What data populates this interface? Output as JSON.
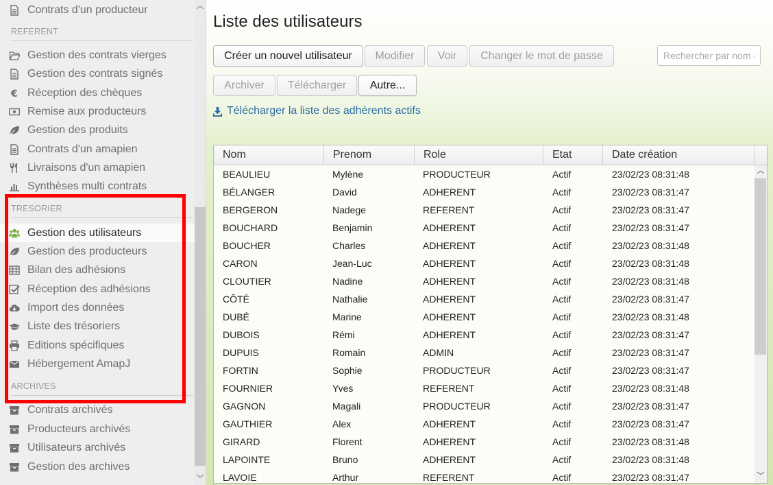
{
  "sidebar": {
    "items_top": [
      {
        "label": "Contrats d'un producteur",
        "icon": "file-icon"
      }
    ],
    "section_referent": "REFERENT",
    "items_referent": [
      {
        "label": "Gestion des contrats vierges",
        "icon": "folder-open-icon"
      },
      {
        "label": "Gestion des contrats signés",
        "icon": "file-icon"
      },
      {
        "label": "Réception des chèques",
        "icon": "euro-icon"
      },
      {
        "label": "Remise aux producteurs",
        "icon": "money-icon"
      },
      {
        "label": "Gestion des produits",
        "icon": "leaf-icon"
      },
      {
        "label": "Contrats d'un amapien",
        "icon": "file-icon"
      },
      {
        "label": "Livraisons d'un amapien",
        "icon": "cutlery-icon"
      },
      {
        "label": "Synthèses multi contrats",
        "icon": "bar-chart-icon"
      }
    ],
    "section_tresorier": "TRESORIER",
    "items_tresorier": [
      {
        "label": "Gestion des utilisateurs",
        "icon": "users-icon",
        "active": true
      },
      {
        "label": "Gestion des producteurs",
        "icon": "leaf-icon"
      },
      {
        "label": "Bilan des adhésions",
        "icon": "table-icon"
      },
      {
        "label": "Réception des adhésions",
        "icon": "check-square-icon"
      },
      {
        "label": "Import des données",
        "icon": "cloud-download-icon"
      },
      {
        "label": "Liste des trésoriers",
        "icon": "graduation-cap-icon"
      },
      {
        "label": "Editions spécifiques",
        "icon": "print-icon"
      },
      {
        "label": "Hébergement AmapJ",
        "icon": "envelope-icon"
      }
    ],
    "section_archives": "ARCHIVES",
    "items_archives": [
      {
        "label": "Contrats archivés",
        "icon": "archive-icon"
      },
      {
        "label": "Producteurs archivés",
        "icon": "archive-icon"
      },
      {
        "label": "Utilisateurs archivés",
        "icon": "archive-icon"
      },
      {
        "label": "Gestion des archives",
        "icon": "archive-icon"
      }
    ]
  },
  "main": {
    "title": "Liste des utilisateurs",
    "toolbar_row1": [
      {
        "label": "Créer un nouvel utilisateur",
        "enabled": true
      },
      {
        "label": "Modifier",
        "enabled": false
      },
      {
        "label": "Voir",
        "enabled": false
      },
      {
        "label": "Changer le mot de passe",
        "enabled": false
      }
    ],
    "toolbar_row2": [
      {
        "label": "Archiver",
        "enabled": false
      },
      {
        "label": "Télécharger",
        "enabled": false
      },
      {
        "label": "Autre...",
        "enabled": true
      }
    ],
    "search_placeholder": "Rechercher par nom ou prénom",
    "download_link": "Télécharger la liste des adhérents actifs",
    "table": {
      "columns": [
        "Nom",
        "Prenom",
        "Role",
        "Etat",
        "Date création"
      ],
      "rows": [
        [
          "BEAULIEU",
          "Mylène",
          "PRODUCTEUR",
          "Actif",
          "23/02/23 08:31:48"
        ],
        [
          "BÉLANGER",
          "David",
          "ADHERENT",
          "Actif",
          "23/02/23 08:31:47"
        ],
        [
          "BERGERON",
          "Nadege",
          "REFERENT",
          "Actif",
          "23/02/23 08:31:47"
        ],
        [
          "BOUCHARD",
          "Benjamin",
          "ADHERENT",
          "Actif",
          "23/02/23 08:31:47"
        ],
        [
          "BOUCHER",
          "Charles",
          "ADHERENT",
          "Actif",
          "23/02/23 08:31:48"
        ],
        [
          "CARON",
          "Jean-Luc",
          "ADHERENT",
          "Actif",
          "23/02/23 08:31:48"
        ],
        [
          "CLOUTIER",
          "Nadine",
          "ADHERENT",
          "Actif",
          "23/02/23 08:31:48"
        ],
        [
          "CÔTÉ",
          "Nathalie",
          "ADHERENT",
          "Actif",
          "23/02/23 08:31:47"
        ],
        [
          "DUBÉ",
          "Marine",
          "ADHERENT",
          "Actif",
          "23/02/23 08:31:48"
        ],
        [
          "DUBOIS",
          "Rémi",
          "ADHERENT",
          "Actif",
          "23/02/23 08:31:47"
        ],
        [
          "DUPUIS",
          "Romain",
          "ADMIN",
          "Actif",
          "23/02/23 08:31:47"
        ],
        [
          "FORTIN",
          "Sophie",
          "PRODUCTEUR",
          "Actif",
          "23/02/23 08:31:47"
        ],
        [
          "FOURNIER",
          "Yves",
          "REFERENT",
          "Actif",
          "23/02/23 08:31:48"
        ],
        [
          "GAGNON",
          "Magali",
          "PRODUCTEUR",
          "Actif",
          "23/02/23 08:31:47"
        ],
        [
          "GAUTHIER",
          "Alex",
          "ADHERENT",
          "Actif",
          "23/02/23 08:31:47"
        ],
        [
          "GIRARD",
          "Florent",
          "ADHERENT",
          "Actif",
          "23/02/23 08:31:48"
        ],
        [
          "LAPOINTE",
          "Bruno",
          "ADHERENT",
          "Actif",
          "23/02/23 08:31:48"
        ],
        [
          "LAVOIE",
          "Arthur",
          "REFERENT",
          "Actif",
          "23/02/23 08:31:47"
        ]
      ]
    }
  },
  "colors": {
    "highlight": "#ff0000",
    "active_icon": "#7bb347",
    "link": "#2e6da4",
    "main_gradient_end": "#d3e6b1"
  }
}
